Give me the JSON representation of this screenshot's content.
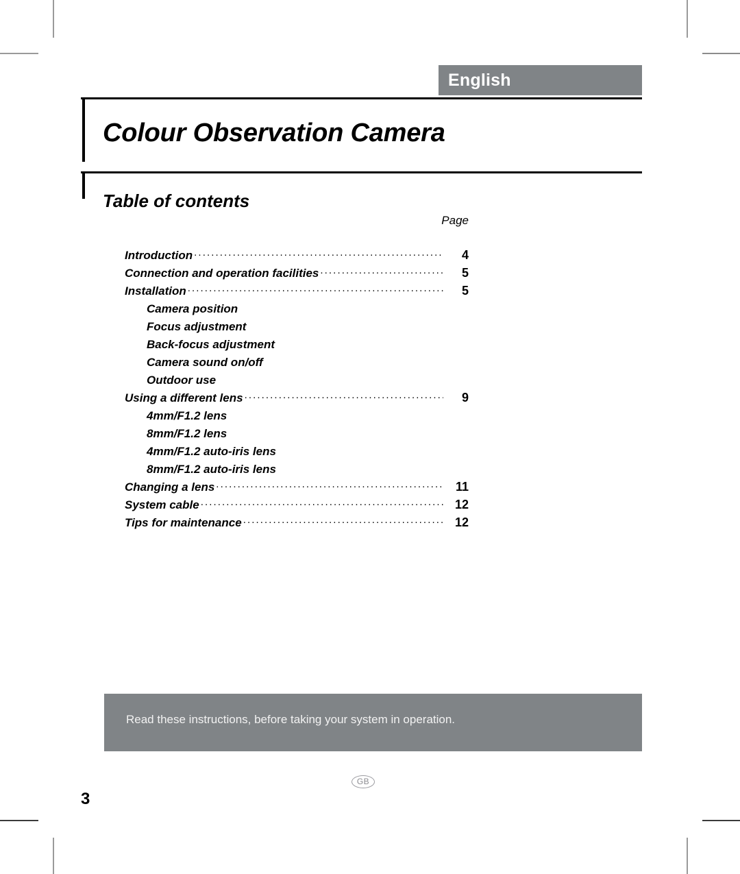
{
  "document": {
    "language_banner": "English",
    "title": "Colour Observation Camera",
    "toc_heading": "Table of contents",
    "page_column_label": "Page"
  },
  "toc": {
    "entries": [
      {
        "label": "Introduction",
        "page": "4",
        "level": 1
      },
      {
        "label": "Connection and operation facilities",
        "page": "5",
        "level": 1
      },
      {
        "label": "Installation",
        "page": "5",
        "level": 1
      },
      {
        "label": "Camera position",
        "page": "",
        "level": 2
      },
      {
        "label": "Focus adjustment",
        "page": "",
        "level": 2
      },
      {
        "label": "Back-focus adjustment",
        "page": "",
        "level": 2
      },
      {
        "label": "Camera sound on/off",
        "page": "",
        "level": 2
      },
      {
        "label": "Outdoor use",
        "page": "",
        "level": 2
      },
      {
        "label": "Using a different lens",
        "page": "9",
        "level": 1
      },
      {
        "label": "4mm/F1.2 lens",
        "page": "",
        "level": 2
      },
      {
        "label": "8mm/F1.2 lens",
        "page": "",
        "level": 2
      },
      {
        "label": "4mm/F1.2 auto-iris lens",
        "page": "",
        "level": 2
      },
      {
        "label": "8mm/F1.2 auto-iris lens",
        "page": "",
        "level": 2
      },
      {
        "label": "Changing a lens",
        "page": "11",
        "level": 1
      },
      {
        "label": "System cable",
        "page": "12",
        "level": 1
      },
      {
        "label": "Tips for maintenance",
        "page": "12",
        "level": 1
      }
    ]
  },
  "notice": {
    "text": "Read these instructions, before taking your system in operation."
  },
  "footer": {
    "region_code": "GB",
    "page_number": "3"
  },
  "colors": {
    "banner_gray": "#808487",
    "notice_gray": "#808487",
    "notice_text": "#f2f2f2",
    "rule_black": "#000000",
    "crop_mark": "#9a9a9a",
    "badge_outline": "#9b9ba0"
  }
}
